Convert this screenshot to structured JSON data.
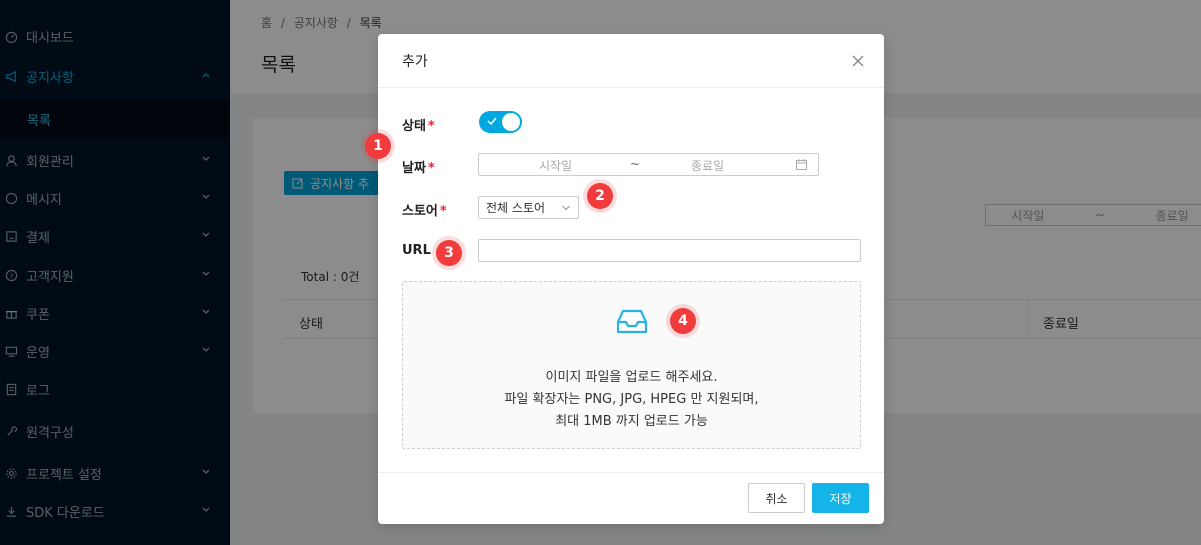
{
  "sidebar": {
    "items": [
      {
        "label": "대시보드",
        "icon": "dashboard-icon"
      },
      {
        "label": "공지사항",
        "icon": "megaphone-icon",
        "active": true
      },
      {
        "label": "회원관리",
        "icon": "user-icon"
      },
      {
        "label": "메시지",
        "icon": "message-icon"
      },
      {
        "label": "결제",
        "icon": "payment-icon"
      },
      {
        "label": "고객지원",
        "icon": "help-icon"
      },
      {
        "label": "쿠폰",
        "icon": "gift-icon"
      },
      {
        "label": "운영",
        "icon": "monitor-icon"
      },
      {
        "label": "로그",
        "icon": "log-icon"
      },
      {
        "label": "원격구성",
        "icon": "wrench-icon"
      },
      {
        "label": "프로젝트 설정",
        "icon": "gear-icon"
      },
      {
        "label": "SDK 다운로드",
        "icon": "download-icon"
      }
    ],
    "sub_item": "목록"
  },
  "breadcrumb": {
    "home": "홈",
    "sep": "/",
    "section": "공지사항",
    "current": "목록"
  },
  "page": {
    "title": "목록",
    "add_button": "공지사항 추",
    "range_start": "시작일",
    "range_tilde": "~",
    "range_end": "종료일",
    "total": "Total : 0건",
    "col_status": "상태",
    "col_end": "종료일"
  },
  "modal": {
    "title": "추가",
    "status_label": "상태",
    "date_label": "날짜",
    "store_label": "스토어",
    "url_label": "URL",
    "required_mark": "*",
    "toggle_on": true,
    "date_start_placeholder": "시작일",
    "date_tilde": "~",
    "date_end_placeholder": "종료일",
    "store_value": "전체 스토어",
    "url_value": "",
    "upload_line1": "이미지 파일을 업로드 해주세요.",
    "upload_line2": "파일 확장자는 PNG, JPG, HPEG 만 지원되며,",
    "upload_line3": "최대 1MB 까지 업로드 가능",
    "cancel_label": "취소",
    "save_label": "저장"
  },
  "badges": [
    "1",
    "2",
    "3",
    "4"
  ],
  "colors": {
    "accent": "#00a8e0",
    "sidebar_bg": "#001529",
    "badge": "#f03c3c",
    "required": "#f5222d"
  }
}
